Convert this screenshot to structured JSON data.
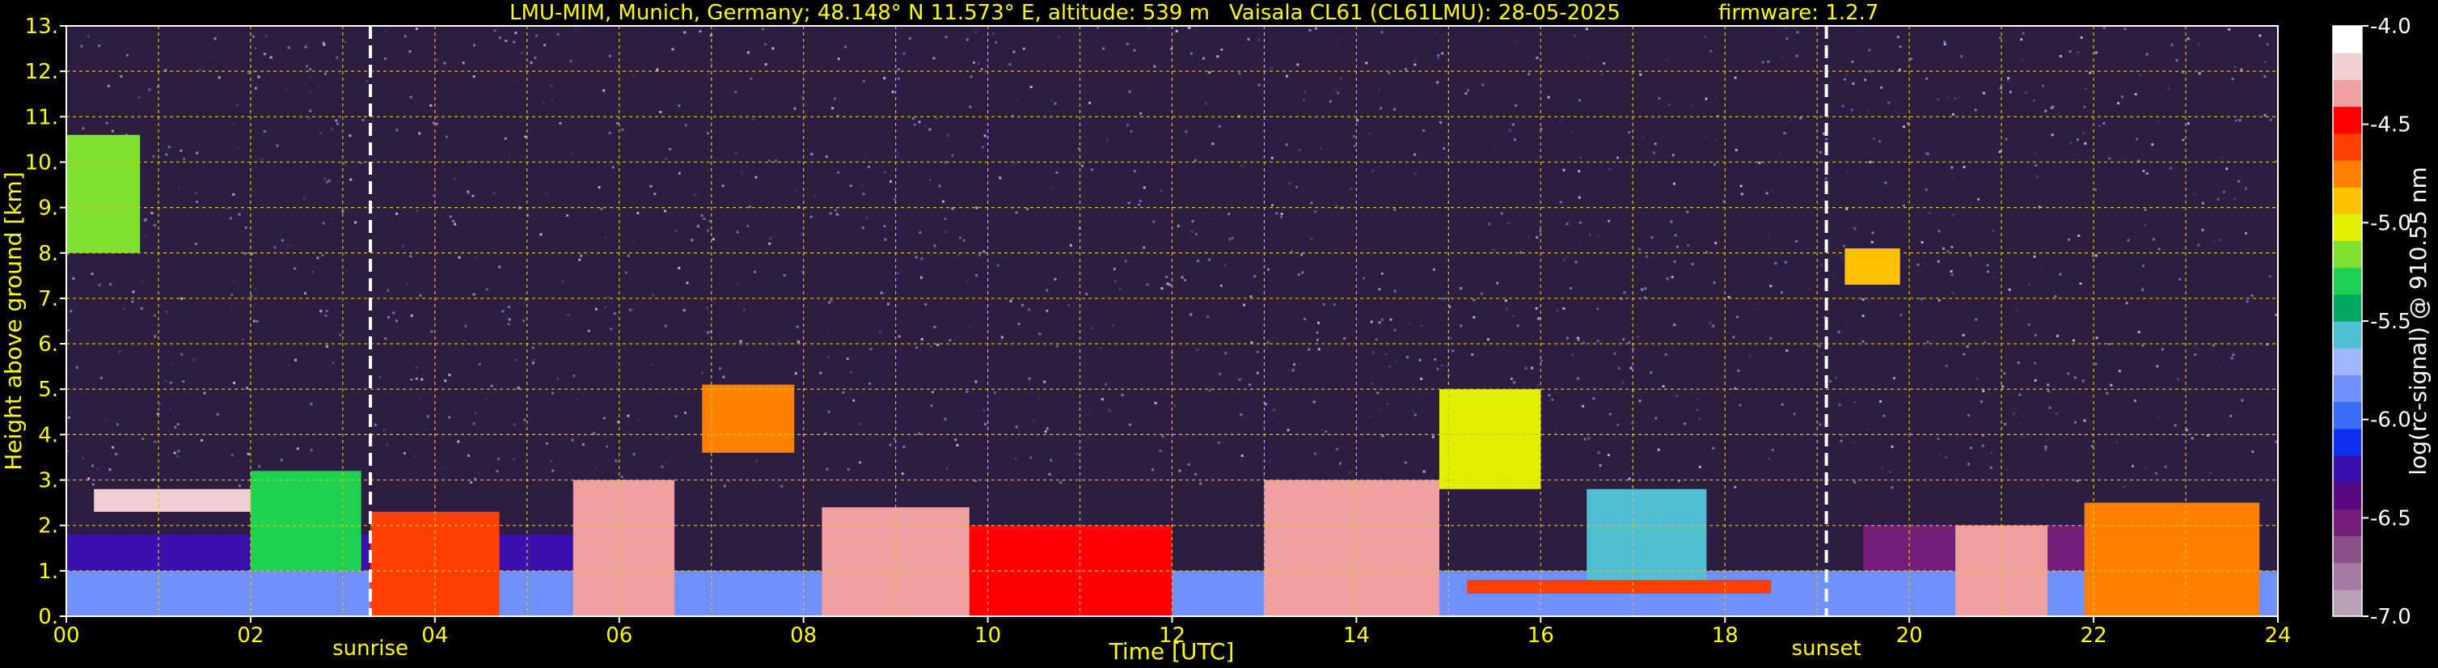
{
  "chart_data": {
    "type": "heatmap",
    "title_parts": [
      "LMU-MIM, Munich, Germany; 48.148° N 11.573° E, altitude: 539 m",
      "Vaisala CL61 (CL61LMU): 28-05-2025",
      "firmware: 1.2.7"
    ],
    "xlabel": "Time [UTC]",
    "ylabel": "Height above ground [km]",
    "x_range_hours": [
      0,
      24
    ],
    "x_ticks": [
      "00",
      "02",
      "04",
      "06",
      "08",
      "10",
      "12",
      "14",
      "16",
      "18",
      "20",
      "22",
      "24"
    ],
    "y_range_km": [
      0,
      13
    ],
    "y_ticks": [
      "0.",
      "1.",
      "2.",
      "3.",
      "4.",
      "5.",
      "6.",
      "7.",
      "8.",
      "9.",
      "10.",
      "11.",
      "12.",
      "13."
    ],
    "grid": true,
    "events": [
      {
        "label": "sunrise",
        "hour": 3.3
      },
      {
        "label": "sunset",
        "hour": 19.1
      }
    ],
    "colorbar": {
      "label": "log(rc-signal) @ 910.55 nm",
      "range": [
        -7.0,
        -4.0
      ],
      "ticks": [
        "-4.0",
        "-4.5",
        "-5.0",
        "-5.5",
        "-6.0",
        "-6.5",
        "-7.0"
      ],
      "colors": [
        "#b9a0b4",
        "#a37aa0",
        "#8c4f8c",
        "#751f7a",
        "#5a0a80",
        "#3a10b0",
        "#1030f0",
        "#3a6cf8",
        "#7090ff",
        "#a0b4ff",
        "#50c0d0",
        "#00a860",
        "#20d050",
        "#80e030",
        "#e0f000",
        "#ffc000",
        "#ff8000",
        "#ff4000",
        "#ff0000",
        "#f0a0a0",
        "#f0d0d0",
        "#ffffff"
      ]
    },
    "cloud_layers": [
      {
        "start": 0.0,
        "end": 24.0,
        "bottom": 0.0,
        "top": 1.0,
        "value": -5.9
      },
      {
        "start": 0.0,
        "end": 5.5,
        "bottom": 1.0,
        "top": 1.8,
        "value": -6.3
      },
      {
        "start": 19.5,
        "end": 23.5,
        "bottom": 1.0,
        "top": 2.0,
        "value": -6.5
      },
      {
        "start": 0.0,
        "end": 0.8,
        "bottom": 8.0,
        "top": 10.6,
        "value": -5.2
      },
      {
        "start": 0.3,
        "end": 2.3,
        "bottom": 2.3,
        "top": 2.8,
        "value": -4.2
      },
      {
        "start": 2.0,
        "end": 3.2,
        "bottom": 1.0,
        "top": 3.2,
        "value": -5.3
      },
      {
        "start": 3.3,
        "end": 4.7,
        "bottom": 0.0,
        "top": 2.3,
        "value": -4.6
      },
      {
        "start": 5.5,
        "end": 6.6,
        "bottom": 0.0,
        "top": 3.0,
        "value": -4.4
      },
      {
        "start": 6.9,
        "end": 7.9,
        "bottom": 3.6,
        "top": 5.1,
        "value": -4.8
      },
      {
        "start": 8.2,
        "end": 9.8,
        "bottom": 0.0,
        "top": 2.4,
        "value": -4.3
      },
      {
        "start": 9.8,
        "end": 12.0,
        "bottom": 0.0,
        "top": 2.0,
        "value": -4.5
      },
      {
        "start": 13.0,
        "end": 14.9,
        "bottom": 0.0,
        "top": 3.0,
        "value": -4.4
      },
      {
        "start": 14.9,
        "end": 16.0,
        "bottom": 2.8,
        "top": 5.0,
        "value": -5.0
      },
      {
        "start": 15.2,
        "end": 18.5,
        "bottom": 0.5,
        "top": 0.8,
        "value": -4.6
      },
      {
        "start": 16.5,
        "end": 17.8,
        "bottom": 0.8,
        "top": 2.8,
        "value": -5.6
      },
      {
        "start": 19.3,
        "end": 19.9,
        "bottom": 7.3,
        "top": 8.1,
        "value": -4.9
      },
      {
        "start": 20.5,
        "end": 21.5,
        "bottom": 0.0,
        "top": 2.0,
        "value": -4.3
      },
      {
        "start": 21.9,
        "end": 23.8,
        "bottom": 0.0,
        "top": 2.5,
        "value": -4.7
      }
    ]
  }
}
